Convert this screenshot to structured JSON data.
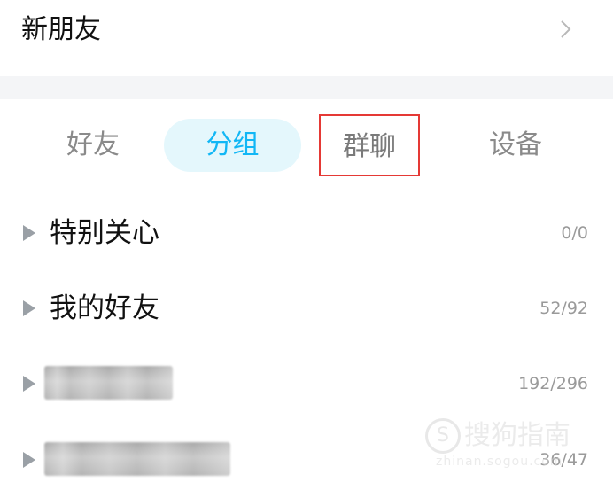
{
  "header": {
    "title": "新朋友"
  },
  "tabs": [
    {
      "label": "好友"
    },
    {
      "label": "分组"
    },
    {
      "label": "群聊"
    },
    {
      "label": "设备"
    }
  ],
  "groups": [
    {
      "name": "特别关心",
      "count": "0/0"
    },
    {
      "name": "我的好友",
      "count": "52/92"
    },
    {
      "name": "",
      "count": "192/296"
    },
    {
      "name": "",
      "count": "36/47"
    }
  ],
  "watermark": {
    "brand": "搜狗指南",
    "url": "zhinan.sogou.com"
  },
  "colors": {
    "active_tab_text": "#12b7f5",
    "active_tab_bg": "#e4f7fc",
    "highlight_border": "#e53935"
  }
}
